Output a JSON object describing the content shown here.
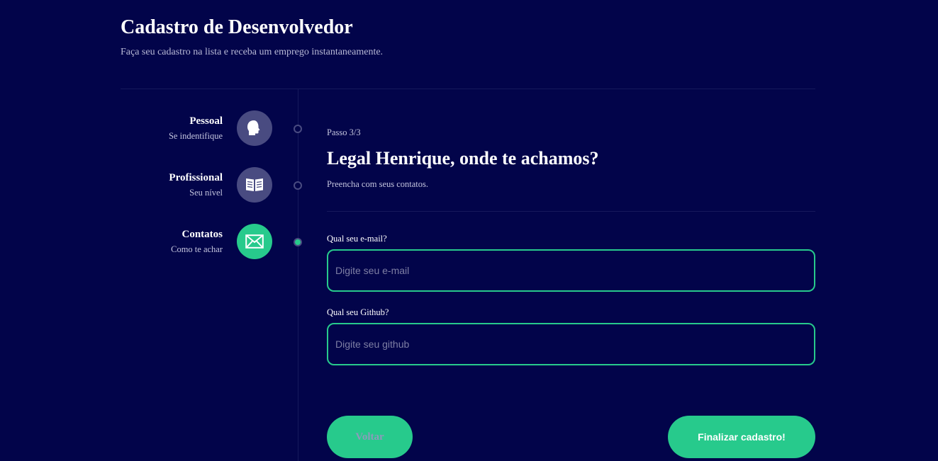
{
  "header": {
    "title": "Cadastro de Desenvolvedor",
    "subtitle": "Faça seu cadastro na lista e receba um emprego instantaneamente."
  },
  "steps": [
    {
      "title": "Pessoal",
      "subtitle": "Se indentifique",
      "icon": "head-icon",
      "active": false
    },
    {
      "title": "Profissional",
      "subtitle": "Seu nível",
      "icon": "book-icon",
      "active": false
    },
    {
      "title": "Contatos",
      "subtitle": "Como te achar",
      "icon": "mail-icon",
      "active": true
    }
  ],
  "main": {
    "step_indicator": "Passo 3/3",
    "title": "Legal Henrique, onde te achamos?",
    "description": "Preencha com seus contatos."
  },
  "form": {
    "email_label": "Qual seu e-mail?",
    "email_placeholder": "Digite seu e-mail",
    "email_value": "",
    "github_label": "Qual seu Github?",
    "github_placeholder": "Digite seu github",
    "github_value": ""
  },
  "buttons": {
    "back_label": "Voltar",
    "finish_label": "Finalizar cadastro!"
  },
  "colors": {
    "background": "#02044a",
    "accent": "#27ca8c",
    "inactive_circle": "#494b81"
  }
}
